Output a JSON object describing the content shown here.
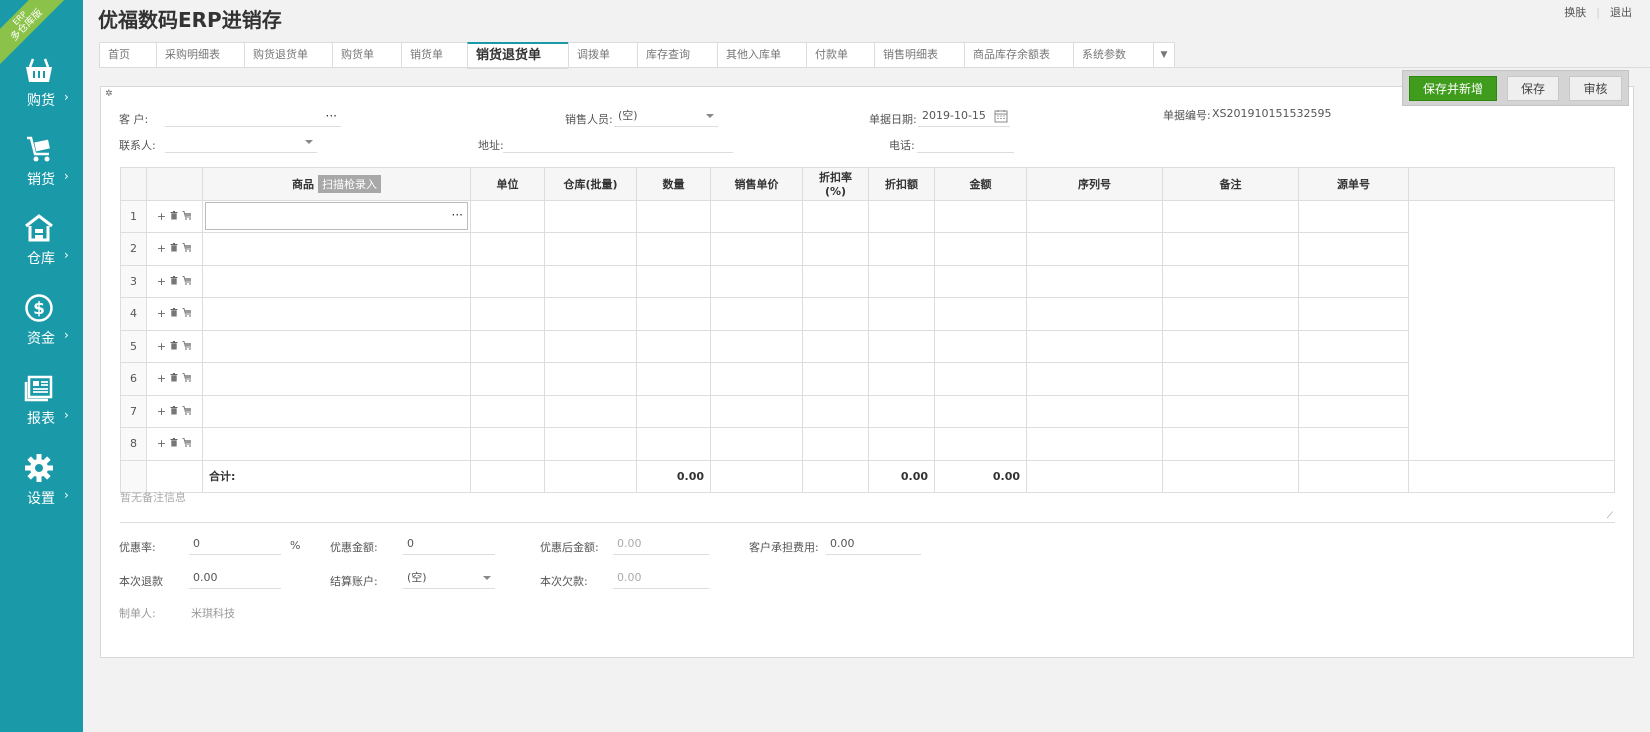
{
  "app": {
    "title": "优福数码ERP进销存",
    "ribbon_line1": "ERP",
    "ribbon_line2": "多仓库版"
  },
  "top_links": {
    "switch_skin": "换肤",
    "logout": "退出"
  },
  "sidebar": {
    "items": [
      {
        "label": "购货",
        "icon": "basket-icon"
      },
      {
        "label": "销货",
        "icon": "cart-icon"
      },
      {
        "label": "仓库",
        "icon": "warehouse-icon"
      },
      {
        "label": "资金",
        "icon": "dollar-icon"
      },
      {
        "label": "报表",
        "icon": "report-icon"
      },
      {
        "label": "设置",
        "icon": "gear-icon"
      }
    ],
    "arrow": "›"
  },
  "tabs": [
    {
      "label": "首页"
    },
    {
      "label": "采购明细表"
    },
    {
      "label": "购货退货单"
    },
    {
      "label": "购货单"
    },
    {
      "label": "销货单"
    },
    {
      "label": "销货退货单",
      "active": true
    },
    {
      "label": "调拨单"
    },
    {
      "label": "库存查询"
    },
    {
      "label": "其他入库单"
    },
    {
      "label": "付款单"
    },
    {
      "label": "销售明细表"
    },
    {
      "label": "商品库存余额表"
    },
    {
      "label": "系统参数"
    }
  ],
  "toolbar": {
    "save_new": "保存并新增",
    "save": "保存",
    "audit": "审核"
  },
  "form": {
    "customer_label": "客    户:",
    "customer_value": "",
    "sales_person_label": "销售人员:",
    "sales_person_value": "(空)",
    "date_label": "单据日期:",
    "date_value": "2019-10-15",
    "order_no_label": "单据编号:",
    "order_no_value": "XS201910151532595",
    "contact_label": "联系人:",
    "contact_value": "",
    "address_label": "地址:",
    "address_value": "",
    "phone_label": "电话:",
    "phone_value": ""
  },
  "grid": {
    "columns": [
      "商品",
      "单位",
      "仓库(批量)",
      "数量",
      "销售单价",
      "折扣率(%)",
      "折扣额",
      "金额",
      "序列号",
      "备注",
      "源单号"
    ],
    "scan_badge": "扫描枪录入",
    "rows": [
      "1",
      "2",
      "3",
      "4",
      "5",
      "6",
      "7",
      "8"
    ],
    "total_label": "合计:",
    "total_qty": "0.00",
    "total_discount": "0.00",
    "total_amount": "0.00"
  },
  "remark_placeholder": "暂无备注信息",
  "footer": {
    "discount_rate_label": "优惠率:",
    "discount_rate_value": "0",
    "percent": "%",
    "discount_amount_label": "优惠金额:",
    "discount_amount_value": "0",
    "after_discount_label": "优惠后金额:",
    "after_discount_value": "0.00",
    "customer_fee_label": "客户承担费用:",
    "customer_fee_value": "0.00",
    "refund_label": "本次退款",
    "refund_value": "0.00",
    "account_label": "结算账户:",
    "account_value": "(空)",
    "owed_label": "本次欠款:",
    "owed_value": "0.00",
    "maker_label": "制单人:",
    "maker_value": "米琪科技"
  },
  "colors": {
    "sidebar": "#1a9aa9",
    "primary_button": "#3f9c1d",
    "ribbon": "#8bc34a"
  }
}
